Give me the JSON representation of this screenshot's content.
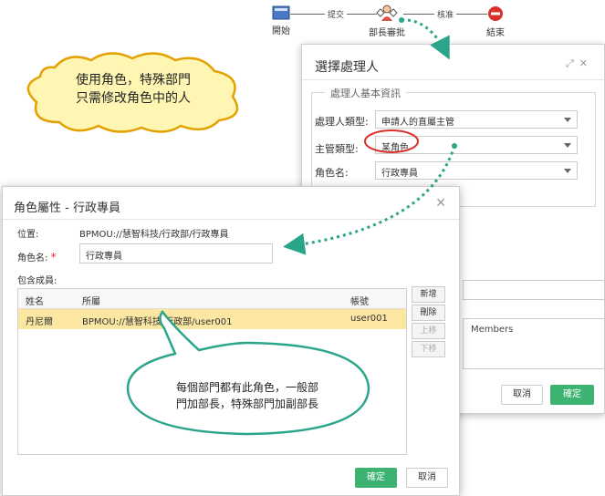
{
  "workflow": {
    "start_label": "開始",
    "submit_label": "提交",
    "node_label": "部長審批",
    "approve_label": "核准",
    "end_label": "結束"
  },
  "back_dialog": {
    "title": "選擇處理人",
    "legend": "處理人基本資訊",
    "handler_type_label": "處理人類型:",
    "handler_type_value": "申請人的直屬主管",
    "supervisor_type_label": "主管類型:",
    "supervisor_type_value": "某角色",
    "role_name_label": "角色名:",
    "role_name_value": "行政專員",
    "members_text": "Members",
    "cancel_label": "取消",
    "ok_label": "確定"
  },
  "front_dialog": {
    "title": "角色屬性 - 行政專員",
    "location_label": "位置:",
    "location_value": "BPMOU://慧智科技/行政部/行政專員",
    "role_name_label": "角色名:",
    "required_mark": "*",
    "role_name_value": "行政專員",
    "members_label": "包含成員:",
    "columns": {
      "name": "姓名",
      "dept": "所屬",
      "account": "帳號"
    },
    "rows": [
      {
        "name": "丹尼爾",
        "dept": "BPMOU://慧智科技/行政部/user001",
        "account": "user001"
      }
    ],
    "buttons": {
      "add": "新增",
      "delete": "刪除",
      "up": "上移",
      "down": "下移"
    },
    "ok_label": "確定",
    "cancel_label": "取消"
  },
  "callouts": {
    "cloud_line1": "使用角色，特殊部門",
    "cloud_line2": "只需修改角色中的人",
    "bubble_line1": "每個部門都有此角色，一般部",
    "bubble_line2": "門加部長，特殊部門加副部長"
  },
  "colors": {
    "accent_green": "#3cb371",
    "highlight_row": "#fbe6a2",
    "callout_green": "#2aa58a",
    "oval_red": "#d9302a"
  }
}
